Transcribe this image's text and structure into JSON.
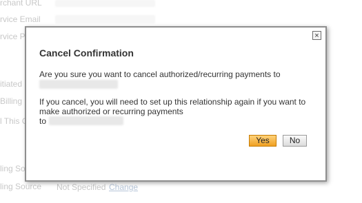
{
  "background": {
    "labels": [
      "rchant URL",
      "rvice Email",
      "rvice P",
      "itiated",
      "Billing",
      "l This C",
      "ling Sourc",
      "ling Source"
    ],
    "billing_source_value": "Not Specified",
    "change_link": "Change"
  },
  "dialog": {
    "close_symbol": "×",
    "title": "Cancel Confirmation",
    "question": "Are you sure you want to cancel authorized/recurring payments to",
    "warning_line1": "If you cancel, you will need to set up this relationship again if you want to",
    "warning_line2": "make authorized or recurring payments",
    "warning_to": "to",
    "yes_label": "Yes",
    "no_label": "No"
  }
}
